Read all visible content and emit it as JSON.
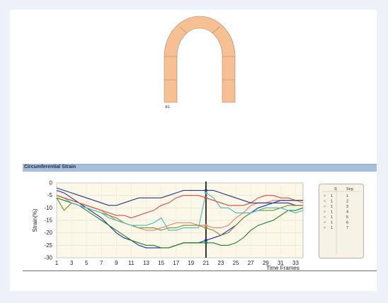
{
  "segment_label": "AS",
  "header": {
    "title": "Circumferential Strain"
  },
  "legend": {
    "columns": [
      "S",
      "Seg"
    ],
    "rows": [
      {
        "mark": "×",
        "s": "1",
        "seg": "1"
      },
      {
        "mark": "×",
        "s": "1",
        "seg": "2"
      },
      {
        "mark": "×",
        "s": "1",
        "seg": "3"
      },
      {
        "mark": "×",
        "s": "1",
        "seg": "4"
      },
      {
        "mark": "×",
        "s": "1",
        "seg": "5"
      },
      {
        "mark": "×",
        "s": "1",
        "seg": "6"
      },
      {
        "mark": "×",
        "s": "1",
        "seg": "7"
      }
    ]
  },
  "chart_data": {
    "type": "line",
    "xlabel": "Time Frames",
    "ylabel": "Strain(%)",
    "xlim": [
      1,
      34
    ],
    "ylim": [
      -30,
      0
    ],
    "x_ticks": [
      1,
      3,
      5,
      7,
      9,
      11,
      13,
      15,
      17,
      19,
      21,
      23,
      25,
      27,
      29,
      31,
      33
    ],
    "y_ticks": [
      0,
      -5,
      -10,
      -15,
      -20,
      -25,
      -30
    ],
    "cursor_frame": 21,
    "background_color": "#fbf8e9",
    "x": [
      1,
      2,
      3,
      4,
      5,
      6,
      7,
      8,
      9,
      10,
      11,
      12,
      13,
      14,
      15,
      16,
      17,
      18,
      19,
      20,
      21,
      22,
      23,
      24,
      25,
      26,
      27,
      28,
      29,
      30,
      31,
      32,
      33,
      34
    ],
    "series": [
      {
        "color": "#1a2f9e",
        "values": [
          -3,
          -4,
          -6,
          -8,
          -10,
          -12,
          -14,
          -17,
          -20,
          -22,
          -23,
          -25,
          -26,
          -26,
          -26,
          -26,
          -25,
          -24,
          -24,
          -24,
          -23,
          -22,
          -21,
          -19,
          -17,
          -14,
          -12,
          -10,
          -9,
          -8,
          -8,
          -8,
          -9,
          -9
        ]
      },
      {
        "color": "#e07b7b",
        "values": [
          -5,
          -6,
          -7,
          -8,
          -9,
          -10,
          -11,
          -13,
          -15,
          -16,
          -17,
          -18,
          -19,
          -19,
          -18,
          -17,
          -16,
          -16,
          -16,
          -17,
          -17,
          -18,
          -18,
          -17,
          -14,
          -12,
          -9,
          -8,
          -8,
          -7,
          -7,
          -7,
          -7,
          -8
        ]
      },
      {
        "color": "#1f7f2a",
        "values": [
          -6,
          -7,
          -8,
          -9,
          -11,
          -13,
          -15,
          -17,
          -19,
          -21,
          -23,
          -24,
          -25,
          -25,
          -26,
          -26,
          -25,
          -24,
          -24,
          -24,
          -24,
          -24,
          -25,
          -25,
          -24,
          -22,
          -19,
          -17,
          -16,
          -15,
          -13,
          -11,
          -11,
          -10
        ]
      },
      {
        "color": "#7c8a1e",
        "values": [
          -6,
          -11,
          -8,
          -9,
          -10,
          -11,
          -12,
          -13,
          -14,
          -16,
          -17,
          -18,
          -18,
          -18,
          -19,
          -18,
          -18,
          -17,
          -17,
          -17,
          -18,
          -19,
          -21,
          -20,
          -17,
          -14,
          -12,
          -11,
          -11,
          -11,
          -10,
          -9,
          -9,
          -9
        ]
      },
      {
        "color": "#3fb8c0",
        "values": [
          -5,
          -6,
          -8,
          -9,
          -10,
          -11,
          -12,
          -14,
          -15,
          -16,
          -17,
          -17,
          -17,
          -16,
          -14,
          -19,
          -19,
          -18,
          -18,
          -18,
          -4,
          -6,
          -10,
          -10,
          -12,
          -12,
          -12,
          -11,
          -10,
          -10,
          -10,
          -11,
          -12,
          -11
        ]
      },
      {
        "color": "#d24a43",
        "values": [
          -5,
          -6,
          -7,
          -8,
          -9,
          -10,
          -11,
          -12,
          -13,
          -13,
          -14,
          -13,
          -12,
          -11,
          -9,
          -8,
          -6,
          -5,
          -5,
          -5,
          -6,
          -7,
          -8,
          -9,
          -9,
          -9,
          -8,
          -6,
          -5,
          -5,
          -6,
          -6,
          -7,
          -7
        ]
      },
      {
        "color": "#243a7a",
        "values": [
          -2,
          -3,
          -4,
          -5,
          -6,
          -7,
          -8,
          -9,
          -9,
          -8,
          -7,
          -6,
          -6,
          -6,
          -6,
          -5,
          -4,
          -3,
          -3,
          -3,
          -3,
          -3,
          -4,
          -5,
          -6,
          -7,
          -8,
          -8,
          -8,
          -8,
          -7,
          -7,
          -7,
          -7
        ]
      }
    ]
  }
}
